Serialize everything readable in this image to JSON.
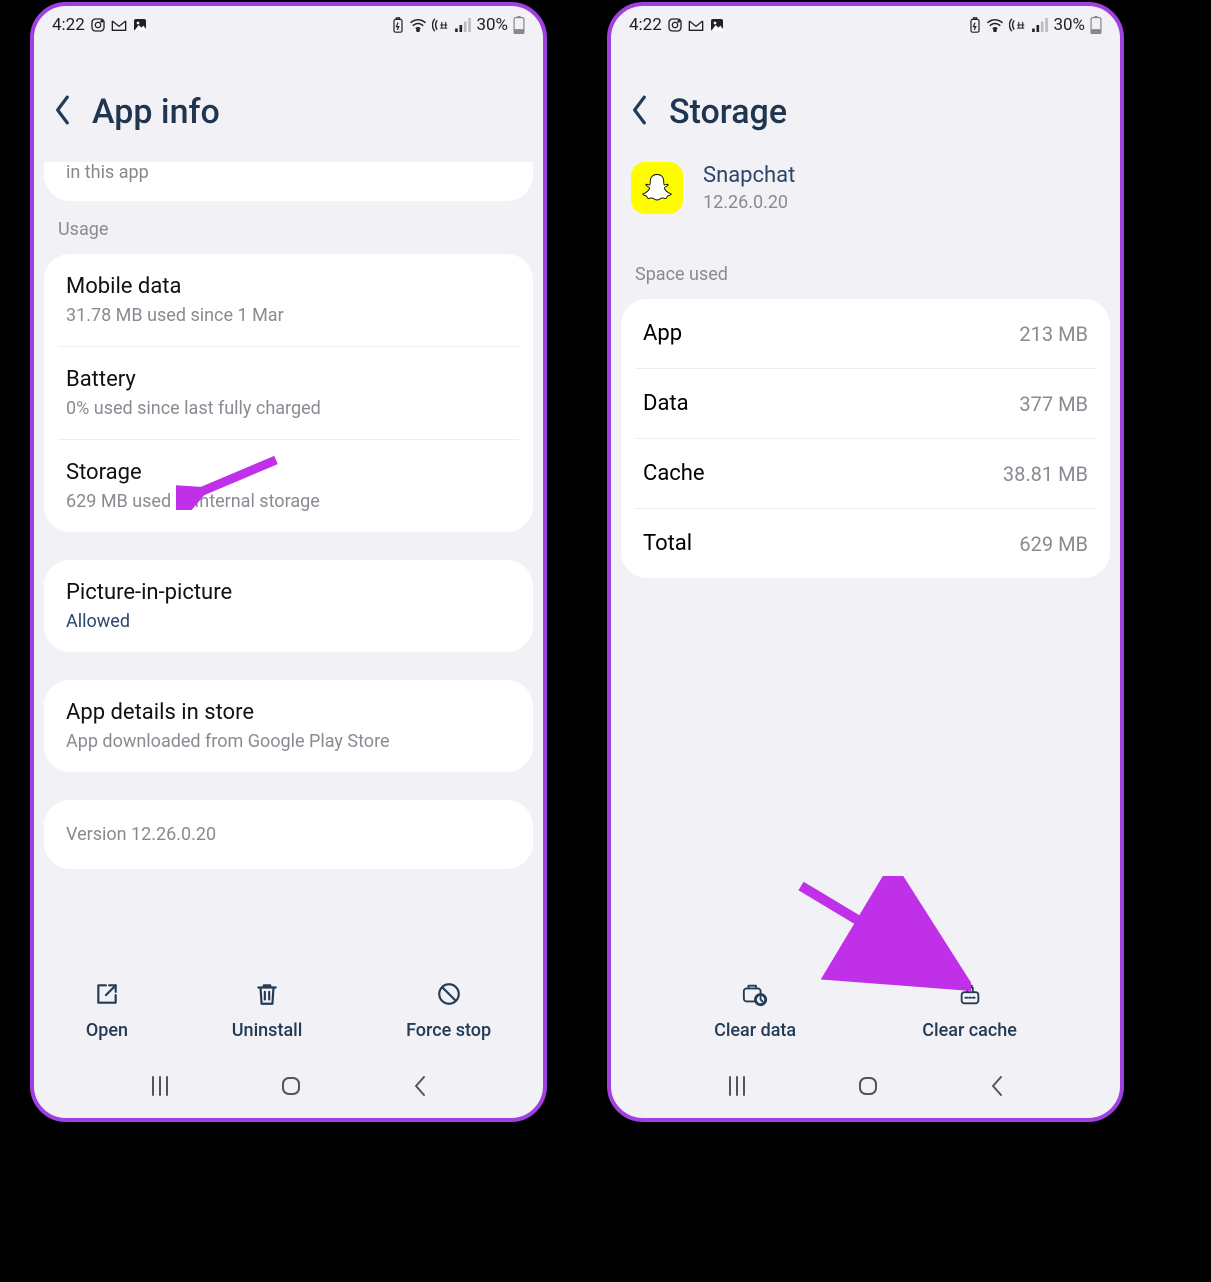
{
  "status": {
    "time": "4:22",
    "battery_text": "30%"
  },
  "left": {
    "header": "App info",
    "cutoff": "in this app",
    "usage_label": "Usage",
    "mobile_data": {
      "title": "Mobile data",
      "sub": "31.78 MB used since 1 Mar"
    },
    "battery": {
      "title": "Battery",
      "sub": "0% used since last fully charged"
    },
    "storage": {
      "title": "Storage",
      "sub": "629 MB used in Internal storage"
    },
    "pip": {
      "title": "Picture-in-picture",
      "sub": "Allowed"
    },
    "store": {
      "title": "App details in store",
      "sub": "App downloaded from Google Play Store"
    },
    "version": "Version 12.26.0.20",
    "actions": {
      "open": "Open",
      "uninstall": "Uninstall",
      "force_stop": "Force stop"
    }
  },
  "right": {
    "header": "Storage",
    "app_name": "Snapchat",
    "app_version": "12.26.0.20",
    "space_label": "Space used",
    "rows": {
      "app": {
        "label": "App",
        "value": "213 MB"
      },
      "data": {
        "label": "Data",
        "value": "377 MB"
      },
      "cache": {
        "label": "Cache",
        "value": "38.81 MB"
      },
      "total": {
        "label": "Total",
        "value": "629 MB"
      }
    },
    "actions": {
      "clear_data": "Clear data",
      "clear_cache": "Clear cache"
    }
  }
}
